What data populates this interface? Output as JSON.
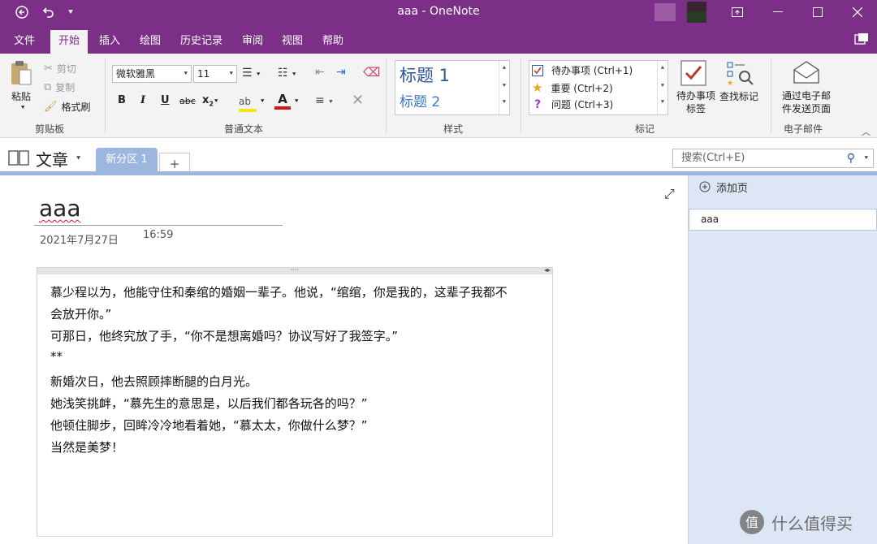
{
  "window": {
    "title": "aaa  -  OneNote"
  },
  "menu": {
    "items": [
      "文件",
      "开始",
      "插入",
      "绘图",
      "历史记录",
      "审阅",
      "视图",
      "帮助"
    ],
    "active_index": 1
  },
  "ribbon": {
    "clipboard": {
      "paste": "粘贴",
      "cut": "剪切",
      "copy": "复制",
      "format_painter": "格式刷",
      "group_label": "剪贴板"
    },
    "basic_text": {
      "font": "微软雅黑",
      "size": "11",
      "group_label": "普通文本"
    },
    "styles": {
      "heading1": "标题 1",
      "heading2": "标题 2",
      "group_label": "样式"
    },
    "tags": {
      "items": [
        "待办事项 (Ctrl+1)",
        "重要 (Ctrl+2)",
        "问题 (Ctrl+3)"
      ],
      "todo_tag": "待办事项标签",
      "find_tags": "查找标记",
      "group_label": "标记"
    },
    "email": {
      "button": "通过电子邮件发送页面",
      "group_label": "电子邮件"
    }
  },
  "notebook": {
    "name": "文章",
    "section_tab": "新分区 1",
    "add_tab": "+"
  },
  "search": {
    "placeholder": "搜索(Ctrl+E)"
  },
  "page": {
    "title": "aaa",
    "date": "2021年7月27日",
    "time": "16:59",
    "lines": [
      "慕少程以为，他能守住和秦绾的婚姻一辈子。他说，“绾绾，你是我的，这辈子我都不",
      "会放开你。”",
      "可那日，他终究放了手，“你不是想离婚吗？协议写好了我签字。”",
      "**",
      "新婚次日，他去照顾摔断腿的白月光。",
      "她浅笑挑衅，“慕先生的意思是，以后我们都各玩各的吗？”",
      "他顿住脚步，回眸冷冷地看着她，“慕太太，你做什么梦？”",
      "当然是美梦！"
    ]
  },
  "pages_panel": {
    "add_page": "添加页",
    "pages": [
      "aaa"
    ]
  },
  "watermark": {
    "text": "什么值得买"
  },
  "colors": {
    "accent": "#7b2f86",
    "panel": "#dce6f4",
    "section_tab": "#9db6df"
  }
}
